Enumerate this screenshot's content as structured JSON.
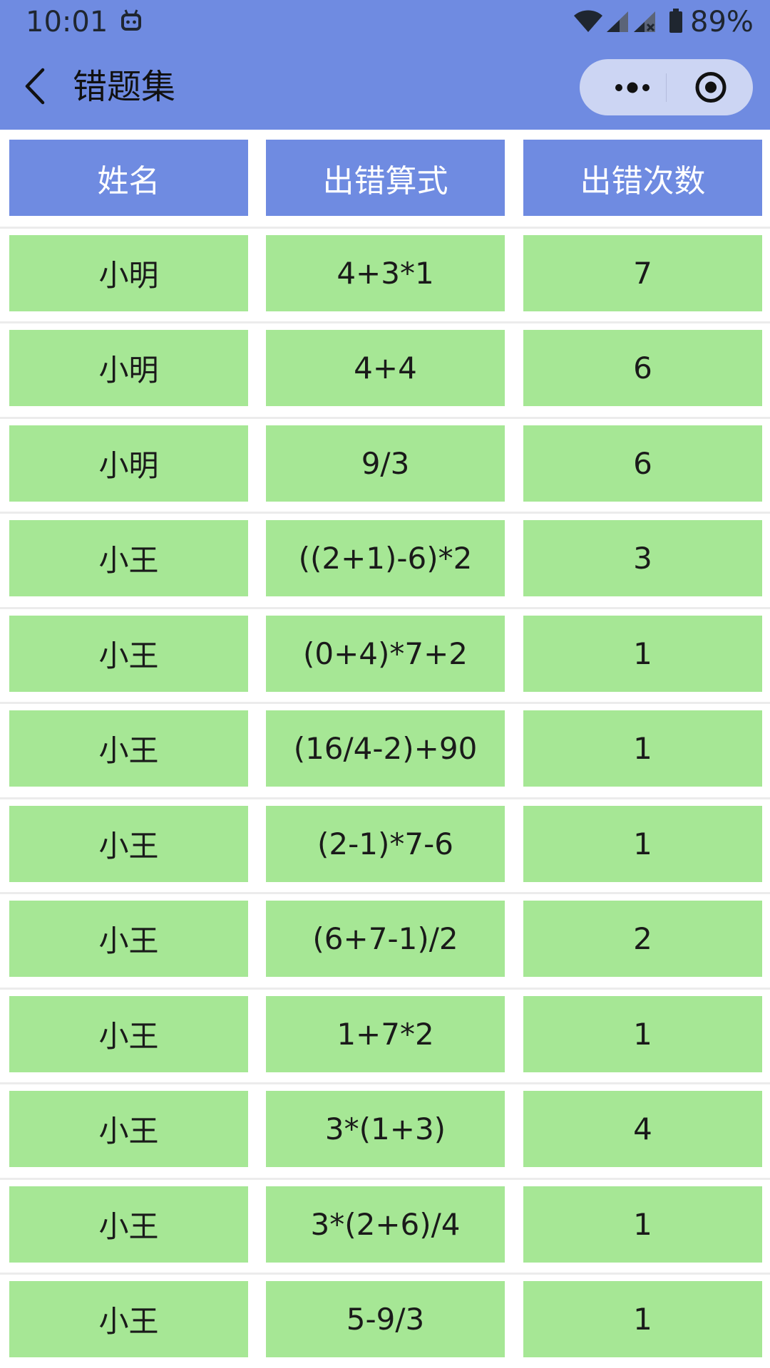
{
  "status_bar": {
    "time": "10:01",
    "battery": "89%",
    "icons": [
      "android-debug-icon",
      "wifi-icon",
      "signal-icon",
      "signal-no-sim-icon",
      "battery-icon"
    ]
  },
  "nav": {
    "title": "错题集",
    "back_icon": "chevron-left-icon",
    "more_icon": "more-dots-icon",
    "close_icon": "target-close-icon"
  },
  "colors": {
    "header_bg": "#6f8be1",
    "header_text": "#ffffff",
    "cell_bg": "#a6e795",
    "capsule_bg": "#ccd5f3"
  },
  "table": {
    "headers": [
      "姓名",
      "出错算式",
      "出错次数"
    ],
    "rows": [
      [
        "小明",
        "4+3*1",
        "7"
      ],
      [
        "小明",
        "4+4",
        "6"
      ],
      [
        "小明",
        "9/3",
        "6"
      ],
      [
        "小王",
        "((2+1)-6)*2",
        "3"
      ],
      [
        "小王",
        "(0+4)*7+2",
        "1"
      ],
      [
        "小王",
        "(16/4-2)+90",
        "1"
      ],
      [
        "小王",
        "(2-1)*7-6",
        "1"
      ],
      [
        "小王",
        "(6+7-1)/2",
        "2"
      ],
      [
        "小王",
        "1+7*2",
        "1"
      ],
      [
        "小王",
        "3*(1+3)",
        "4"
      ],
      [
        "小王",
        "3*(2+6)/4",
        "1"
      ],
      [
        "小王",
        "5-9/3",
        "1"
      ]
    ]
  }
}
